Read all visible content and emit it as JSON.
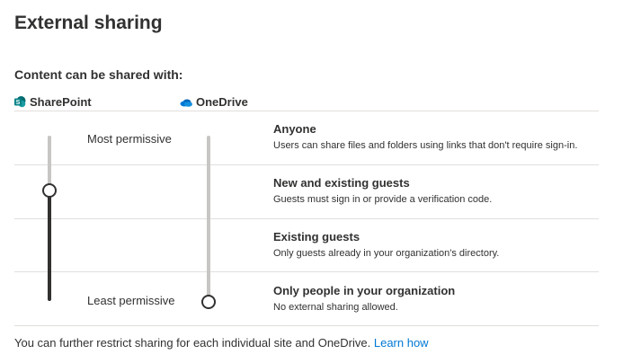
{
  "page": {
    "title": "External sharing",
    "subtitle": "Content can be shared with:"
  },
  "apps": {
    "sharepoint": {
      "label": "SharePoint",
      "icon": "sharepoint-icon",
      "color": "#038387"
    },
    "onedrive": {
      "label": "OneDrive",
      "icon": "onedrive-icon",
      "color": "#0078d4"
    }
  },
  "slider_labels": {
    "most": "Most permissive",
    "least": "Least permissive"
  },
  "sharepoint_level": "New and existing guests",
  "onedrive_level": "Only people in your organization",
  "options": [
    {
      "title": "Anyone",
      "description": "Users can share files and folders using links that don't require sign-in."
    },
    {
      "title": "New and existing guests",
      "description": "Guests must sign in or provide a verification code."
    },
    {
      "title": "Existing guests",
      "description": "Only guests already in your organization's directory."
    },
    {
      "title": "Only people in your organization",
      "description": "No external sharing allowed."
    }
  ],
  "footer": {
    "text": "You can further restrict sharing for each individual site and OneDrive.",
    "link": "Learn how"
  },
  "colors": {
    "text": "#323130",
    "link": "#0078d4",
    "divider": "#e1dfdd",
    "track_inactive": "#c8c6c4",
    "track_active": "#323130"
  }
}
